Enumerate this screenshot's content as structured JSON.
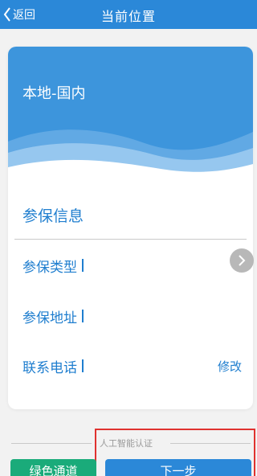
{
  "header": {
    "back_label": "返回",
    "title": "当前位置",
    "back_icon": "chevron-left-icon"
  },
  "card": {
    "region": "本地-国内",
    "section_title": "参保信息",
    "fields": [
      {
        "label": "参保类型"
      },
      {
        "label": "参保地址"
      },
      {
        "label": "联系电话"
      }
    ],
    "edit_label": "修改",
    "side_icon": "chevron-right-icon"
  },
  "footer": {
    "ai_label": "人工智能认证",
    "green_button": "绿色通道",
    "next_button": "下一步"
  },
  "colors": {
    "primary": "#2b88d8",
    "header_band": "#3d95dc",
    "accent_text": "#1f7ecf",
    "green": "#1aab7a",
    "highlight": "#e0322f"
  }
}
